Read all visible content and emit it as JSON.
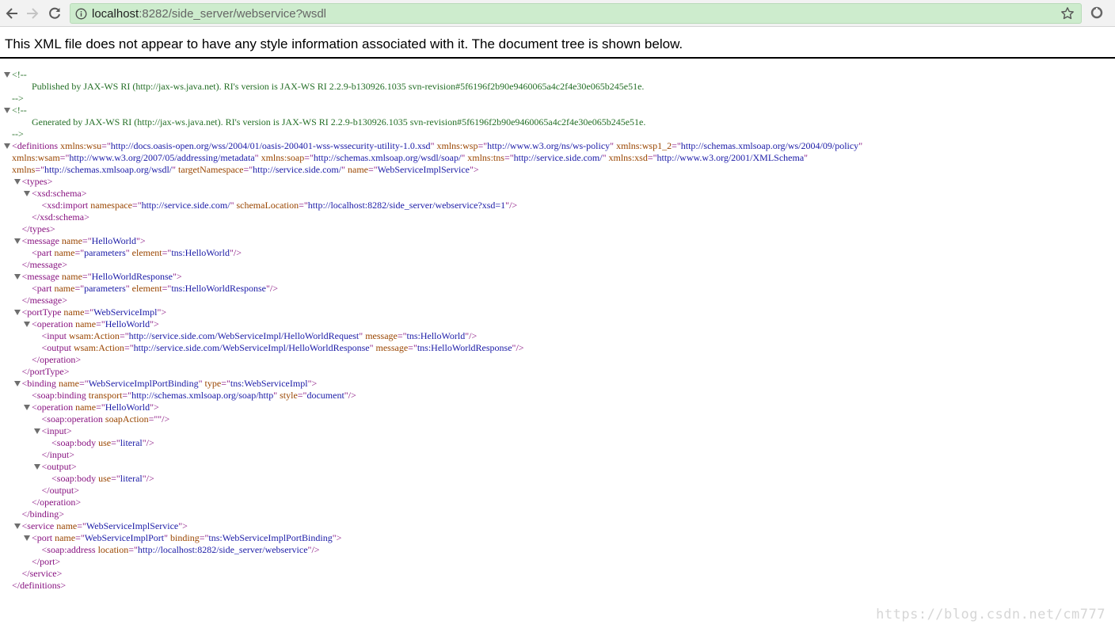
{
  "browser": {
    "url_host": "localhost",
    "url_rest": ":8282/side_server/webservice?wsdl",
    "accent": "#cdeccd"
  },
  "banner": "This XML file does not appear to have any style information associated with it. The document tree is shown below.",
  "watermark": "https://blog.csdn.net/cm777",
  "xml_lines": [
    {
      "indent": 0,
      "arrow": true,
      "tokens": [
        [
          "cm",
          "<!--"
        ]
      ]
    },
    {
      "indent": 2,
      "arrow": false,
      "tokens": [
        [
          "cm",
          "Published by JAX-WS RI (http://jax-ws.java.net). RI's version is JAX-WS RI 2.2.9-b130926.1035 svn-revision#5f6196f2b90e9460065a4c2f4e30e065b245e51e."
        ]
      ]
    },
    {
      "indent": 0,
      "arrow": false,
      "tokens": [
        [
          "cm",
          "-->"
        ]
      ]
    },
    {
      "indent": 0,
      "arrow": true,
      "tokens": [
        [
          "cm",
          "<!--"
        ]
      ]
    },
    {
      "indent": 2,
      "arrow": false,
      "tokens": [
        [
          "cm",
          "Generated by JAX-WS RI (http://jax-ws.java.net). RI's version is JAX-WS RI 2.2.9-b130926.1035 svn-revision#5f6196f2b90e9460065a4c2f4e30e065b245e51e."
        ]
      ]
    },
    {
      "indent": 0,
      "arrow": false,
      "tokens": [
        [
          "cm",
          "-->"
        ]
      ]
    },
    {
      "indent": 0,
      "arrow": true,
      "tokens": [
        [
          "tag",
          "<definitions "
        ],
        [
          "an",
          "xmlns:wsu"
        ],
        [
          "tag",
          "=\""
        ],
        [
          "av",
          "http://docs.oasis-open.org/wss/2004/01/oasis-200401-wss-wssecurity-utility-1.0.xsd"
        ],
        [
          "tag",
          "\" "
        ],
        [
          "an",
          "xmlns:wsp"
        ],
        [
          "tag",
          "=\""
        ],
        [
          "av",
          "http://www.w3.org/ns/ws-policy"
        ],
        [
          "tag",
          "\" "
        ],
        [
          "an",
          "xmlns:wsp1_2"
        ],
        [
          "tag",
          "=\""
        ],
        [
          "av",
          "http://schemas.xmlsoap.org/ws/2004/09/policy"
        ],
        [
          "tag",
          "\""
        ]
      ]
    },
    {
      "indent": 0,
      "arrow": false,
      "tokens": [
        [
          "an",
          "xmlns:wsam"
        ],
        [
          "tag",
          "=\""
        ],
        [
          "av",
          "http://www.w3.org/2007/05/addressing/metadata"
        ],
        [
          "tag",
          "\" "
        ],
        [
          "an",
          "xmlns:soap"
        ],
        [
          "tag",
          "=\""
        ],
        [
          "av",
          "http://schemas.xmlsoap.org/wsdl/soap/"
        ],
        [
          "tag",
          "\" "
        ],
        [
          "an",
          "xmlns:tns"
        ],
        [
          "tag",
          "=\""
        ],
        [
          "av",
          "http://service.side.com/"
        ],
        [
          "tag",
          "\" "
        ],
        [
          "an",
          "xmlns:xsd"
        ],
        [
          "tag",
          "=\""
        ],
        [
          "av",
          "http://www.w3.org/2001/XMLSchema"
        ],
        [
          "tag",
          "\""
        ]
      ]
    },
    {
      "indent": 0,
      "arrow": false,
      "tokens": [
        [
          "an",
          "xmlns"
        ],
        [
          "tag",
          "=\""
        ],
        [
          "av",
          "http://schemas.xmlsoap.org/wsdl/"
        ],
        [
          "tag",
          "\" "
        ],
        [
          "an",
          "targetNamespace"
        ],
        [
          "tag",
          "=\""
        ],
        [
          "av",
          "http://service.side.com/"
        ],
        [
          "tag",
          "\" "
        ],
        [
          "an",
          "name"
        ],
        [
          "tag",
          "=\""
        ],
        [
          "av",
          "WebServiceImplService"
        ],
        [
          "tag",
          "\">"
        ]
      ]
    },
    {
      "indent": 1,
      "arrow": true,
      "tokens": [
        [
          "tag",
          "<types>"
        ]
      ]
    },
    {
      "indent": 2,
      "arrow": true,
      "tokens": [
        [
          "tag",
          "<xsd:schema>"
        ]
      ]
    },
    {
      "indent": 3,
      "arrow": false,
      "tokens": [
        [
          "tag",
          "<xsd:import "
        ],
        [
          "an",
          "namespace"
        ],
        [
          "tag",
          "=\""
        ],
        [
          "av",
          "http://service.side.com/"
        ],
        [
          "tag",
          "\" "
        ],
        [
          "an",
          "schemaLocation"
        ],
        [
          "tag",
          "=\""
        ],
        [
          "av",
          "http://localhost:8282/side_server/webservice?xsd=1"
        ],
        [
          "tag",
          "\"/>"
        ]
      ]
    },
    {
      "indent": 2,
      "arrow": false,
      "tokens": [
        [
          "tag",
          "</xsd:schema>"
        ]
      ]
    },
    {
      "indent": 1,
      "arrow": false,
      "tokens": [
        [
          "tag",
          "</types>"
        ]
      ]
    },
    {
      "indent": 1,
      "arrow": true,
      "tokens": [
        [
          "tag",
          "<message "
        ],
        [
          "an",
          "name"
        ],
        [
          "tag",
          "=\""
        ],
        [
          "av",
          "HelloWorld"
        ],
        [
          "tag",
          "\">"
        ]
      ]
    },
    {
      "indent": 2,
      "arrow": false,
      "tokens": [
        [
          "tag",
          "<part "
        ],
        [
          "an",
          "name"
        ],
        [
          "tag",
          "=\""
        ],
        [
          "av",
          "parameters"
        ],
        [
          "tag",
          "\" "
        ],
        [
          "an",
          "element"
        ],
        [
          "tag",
          "=\""
        ],
        [
          "av",
          "tns:HelloWorld"
        ],
        [
          "tag",
          "\"/>"
        ]
      ]
    },
    {
      "indent": 1,
      "arrow": false,
      "tokens": [
        [
          "tag",
          "</message>"
        ]
      ]
    },
    {
      "indent": 1,
      "arrow": true,
      "tokens": [
        [
          "tag",
          "<message "
        ],
        [
          "an",
          "name"
        ],
        [
          "tag",
          "=\""
        ],
        [
          "av",
          "HelloWorldResponse"
        ],
        [
          "tag",
          "\">"
        ]
      ]
    },
    {
      "indent": 2,
      "arrow": false,
      "tokens": [
        [
          "tag",
          "<part "
        ],
        [
          "an",
          "name"
        ],
        [
          "tag",
          "=\""
        ],
        [
          "av",
          "parameters"
        ],
        [
          "tag",
          "\" "
        ],
        [
          "an",
          "element"
        ],
        [
          "tag",
          "=\""
        ],
        [
          "av",
          "tns:HelloWorldResponse"
        ],
        [
          "tag",
          "\"/>"
        ]
      ]
    },
    {
      "indent": 1,
      "arrow": false,
      "tokens": [
        [
          "tag",
          "</message>"
        ]
      ]
    },
    {
      "indent": 1,
      "arrow": true,
      "tokens": [
        [
          "tag",
          "<portType "
        ],
        [
          "an",
          "name"
        ],
        [
          "tag",
          "=\""
        ],
        [
          "av",
          "WebServiceImpl"
        ],
        [
          "tag",
          "\">"
        ]
      ]
    },
    {
      "indent": 2,
      "arrow": true,
      "tokens": [
        [
          "tag",
          "<operation "
        ],
        [
          "an",
          "name"
        ],
        [
          "tag",
          "=\""
        ],
        [
          "av",
          "HelloWorld"
        ],
        [
          "tag",
          "\">"
        ]
      ]
    },
    {
      "indent": 3,
      "arrow": false,
      "tokens": [
        [
          "tag",
          "<input "
        ],
        [
          "an",
          "wsam:Action"
        ],
        [
          "tag",
          "=\""
        ],
        [
          "av",
          "http://service.side.com/WebServiceImpl/HelloWorldRequest"
        ],
        [
          "tag",
          "\" "
        ],
        [
          "an",
          "message"
        ],
        [
          "tag",
          "=\""
        ],
        [
          "av",
          "tns:HelloWorld"
        ],
        [
          "tag",
          "\"/>"
        ]
      ]
    },
    {
      "indent": 3,
      "arrow": false,
      "tokens": [
        [
          "tag",
          "<output "
        ],
        [
          "an",
          "wsam:Action"
        ],
        [
          "tag",
          "=\""
        ],
        [
          "av",
          "http://service.side.com/WebServiceImpl/HelloWorldResponse"
        ],
        [
          "tag",
          "\" "
        ],
        [
          "an",
          "message"
        ],
        [
          "tag",
          "=\""
        ],
        [
          "av",
          "tns:HelloWorldResponse"
        ],
        [
          "tag",
          "\"/>"
        ]
      ]
    },
    {
      "indent": 2,
      "arrow": false,
      "tokens": [
        [
          "tag",
          "</operation>"
        ]
      ]
    },
    {
      "indent": 1,
      "arrow": false,
      "tokens": [
        [
          "tag",
          "</portType>"
        ]
      ]
    },
    {
      "indent": 1,
      "arrow": true,
      "tokens": [
        [
          "tag",
          "<binding "
        ],
        [
          "an",
          "name"
        ],
        [
          "tag",
          "=\""
        ],
        [
          "av",
          "WebServiceImplPortBinding"
        ],
        [
          "tag",
          "\" "
        ],
        [
          "an",
          "type"
        ],
        [
          "tag",
          "=\""
        ],
        [
          "av",
          "tns:WebServiceImpl"
        ],
        [
          "tag",
          "\">"
        ]
      ]
    },
    {
      "indent": 2,
      "arrow": false,
      "tokens": [
        [
          "tag",
          "<soap:binding "
        ],
        [
          "an",
          "transport"
        ],
        [
          "tag",
          "=\""
        ],
        [
          "av",
          "http://schemas.xmlsoap.org/soap/http"
        ],
        [
          "tag",
          "\" "
        ],
        [
          "an",
          "style"
        ],
        [
          "tag",
          "=\""
        ],
        [
          "av",
          "document"
        ],
        [
          "tag",
          "\"/>"
        ]
      ]
    },
    {
      "indent": 2,
      "arrow": true,
      "tokens": [
        [
          "tag",
          "<operation "
        ],
        [
          "an",
          "name"
        ],
        [
          "tag",
          "=\""
        ],
        [
          "av",
          "HelloWorld"
        ],
        [
          "tag",
          "\">"
        ]
      ]
    },
    {
      "indent": 3,
      "arrow": false,
      "tokens": [
        [
          "tag",
          "<soap:operation "
        ],
        [
          "an",
          "soapAction"
        ],
        [
          "tag",
          "=\"\"/>"
        ]
      ]
    },
    {
      "indent": 3,
      "arrow": true,
      "tokens": [
        [
          "tag",
          "<input>"
        ]
      ]
    },
    {
      "indent": 4,
      "arrow": false,
      "tokens": [
        [
          "tag",
          "<soap:body "
        ],
        [
          "an",
          "use"
        ],
        [
          "tag",
          "=\""
        ],
        [
          "av",
          "literal"
        ],
        [
          "tag",
          "\"/>"
        ]
      ]
    },
    {
      "indent": 3,
      "arrow": false,
      "tokens": [
        [
          "tag",
          "</input>"
        ]
      ]
    },
    {
      "indent": 3,
      "arrow": true,
      "tokens": [
        [
          "tag",
          "<output>"
        ]
      ]
    },
    {
      "indent": 4,
      "arrow": false,
      "tokens": [
        [
          "tag",
          "<soap:body "
        ],
        [
          "an",
          "use"
        ],
        [
          "tag",
          "=\""
        ],
        [
          "av",
          "literal"
        ],
        [
          "tag",
          "\"/>"
        ]
      ]
    },
    {
      "indent": 3,
      "arrow": false,
      "tokens": [
        [
          "tag",
          "</output>"
        ]
      ]
    },
    {
      "indent": 2,
      "arrow": false,
      "tokens": [
        [
          "tag",
          "</operation>"
        ]
      ]
    },
    {
      "indent": 1,
      "arrow": false,
      "tokens": [
        [
          "tag",
          "</binding>"
        ]
      ]
    },
    {
      "indent": 1,
      "arrow": true,
      "tokens": [
        [
          "tag",
          "<service "
        ],
        [
          "an",
          "name"
        ],
        [
          "tag",
          "=\""
        ],
        [
          "av",
          "WebServiceImplService"
        ],
        [
          "tag",
          "\">"
        ]
      ]
    },
    {
      "indent": 2,
      "arrow": true,
      "tokens": [
        [
          "tag",
          "<port "
        ],
        [
          "an",
          "name"
        ],
        [
          "tag",
          "=\""
        ],
        [
          "av",
          "WebServiceImplPort"
        ],
        [
          "tag",
          "\" "
        ],
        [
          "an",
          "binding"
        ],
        [
          "tag",
          "=\""
        ],
        [
          "av",
          "tns:WebServiceImplPortBinding"
        ],
        [
          "tag",
          "\">"
        ]
      ]
    },
    {
      "indent": 3,
      "arrow": false,
      "tokens": [
        [
          "tag",
          "<soap:address "
        ],
        [
          "an",
          "location"
        ],
        [
          "tag",
          "=\""
        ],
        [
          "av",
          "http://localhost:8282/side_server/webservice"
        ],
        [
          "tag",
          "\"/>"
        ]
      ]
    },
    {
      "indent": 2,
      "arrow": false,
      "tokens": [
        [
          "tag",
          "</port>"
        ]
      ]
    },
    {
      "indent": 1,
      "arrow": false,
      "tokens": [
        [
          "tag",
          "</service>"
        ]
      ]
    },
    {
      "indent": 0,
      "arrow": false,
      "tokens": [
        [
          "tag",
          "</definitions>"
        ]
      ]
    }
  ]
}
